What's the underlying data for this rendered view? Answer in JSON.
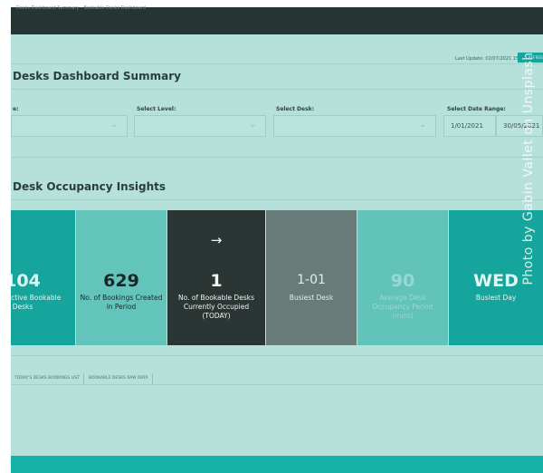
{
  "topbar": {
    "text": "Desks Dashboard Summary - Bookable Desks Dashboard"
  },
  "header": {
    "last_update": "Last Update: 02/07/2021 15:22:08",
    "refresh_label": "REFRESH"
  },
  "summary": {
    "title": "Desks Dashboard Summary"
  },
  "filters": {
    "first_label": "e:",
    "level_label": "Select Level:",
    "desk_label": "Select Desk:",
    "date_label": "Select Date Range:",
    "date_start": "1/01/2021",
    "date_end": "30/05/2021"
  },
  "insights": {
    "title": "Desk Occupancy Insights",
    "cards": [
      {
        "value": "104",
        "label": "No. of Active Bookable Desks"
      },
      {
        "value": "629",
        "label": "No. of Bookings Created in Period"
      },
      {
        "value": "1",
        "label": "No. of Bookable Desks Currently Occupied (TODAY)"
      },
      {
        "value": "1-01",
        "label": "Busiest Desk"
      },
      {
        "value": "90",
        "label": "Average Desk Occupancy Period (mins)"
      },
      {
        "value": "WED",
        "label": "Busiest Day"
      }
    ]
  },
  "tabs": [
    {
      "label": "TODAY'S DESKS BOOKINGS LIST"
    },
    {
      "label": "BOOKABLE DESKS RAW DATA"
    }
  ],
  "watermark": "Photo by Gabin Vallet on Unsplash",
  "icons": {
    "arrow": "arrow-right-icon",
    "chevron": "chevron-down-icon"
  },
  "colors": {
    "background": "#b5e1da",
    "accent": "#15a59c",
    "dark_card": "#2b3634",
    "grey_card": "#677c79",
    "light_card": "#62c3bb",
    "topbar": "#253533"
  }
}
